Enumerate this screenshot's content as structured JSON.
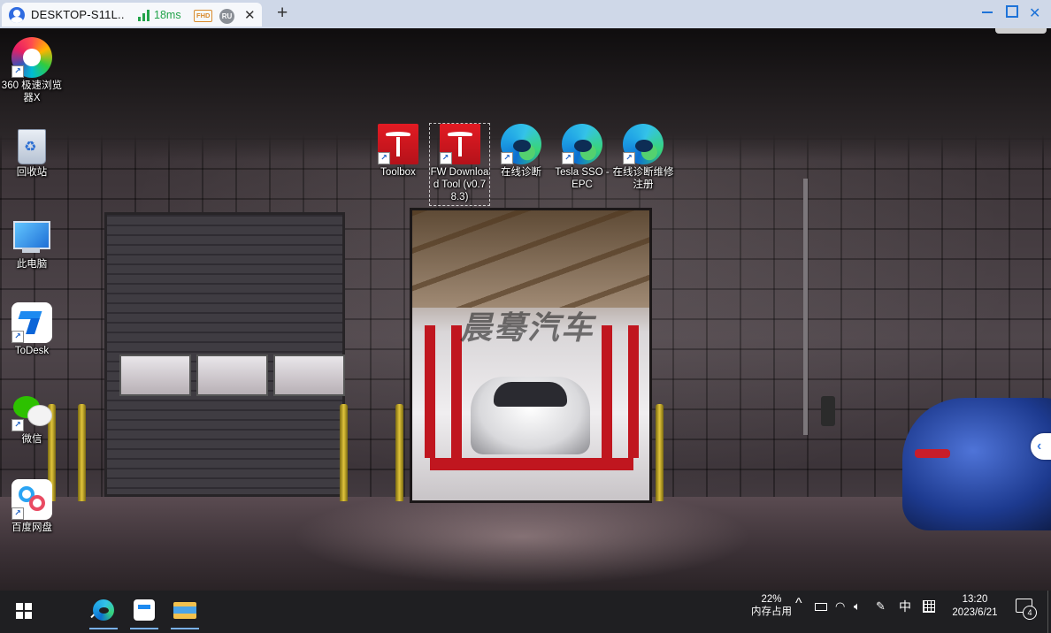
{
  "client": {
    "tab_title": "DESKTOP-S11L..",
    "latency": "18ms",
    "quality_badge": "FHD",
    "user_badge": "RU",
    "close_glyph": "✕",
    "new_tab_glyph": "+",
    "accent_color": "#1e73d8"
  },
  "desktop": {
    "watermark": "晨蓦汽车",
    "icons_left": [
      {
        "label": "360 极速浏览器X",
        "icon": "360-browser-icon"
      },
      {
        "label": "回收站",
        "icon": "recycle-bin-icon"
      },
      {
        "label": "此电脑",
        "icon": "this-pc-icon"
      },
      {
        "label": "ToDesk",
        "icon": "todesk-icon"
      },
      {
        "label": "微信",
        "icon": "wechat-icon"
      },
      {
        "label": "百度网盘",
        "icon": "baidu-netdisk-icon"
      }
    ],
    "icons_top": [
      {
        "label": "Toolbox",
        "icon": "tesla-icon"
      },
      {
        "label": "FW Download Tool (v0.78.3)",
        "icon": "tesla-icon"
      },
      {
        "label": "在线诊断",
        "icon": "edge-icon"
      },
      {
        "label": "Tesla SSO - EPC",
        "icon": "edge-icon"
      },
      {
        "label": "在线诊断维修注册",
        "icon": "edge-icon"
      }
    ],
    "side_handle_glyph": "‹"
  },
  "taskbar": {
    "apps": [
      "edge-icon",
      "todesk-icon",
      "file-explorer-icon"
    ],
    "memory_percent": "22%",
    "memory_label": "内存占用",
    "tray_chevron": "^",
    "ime_lang": "中",
    "time": "13:20",
    "date": "2023/6/21",
    "notification_count": "4"
  }
}
